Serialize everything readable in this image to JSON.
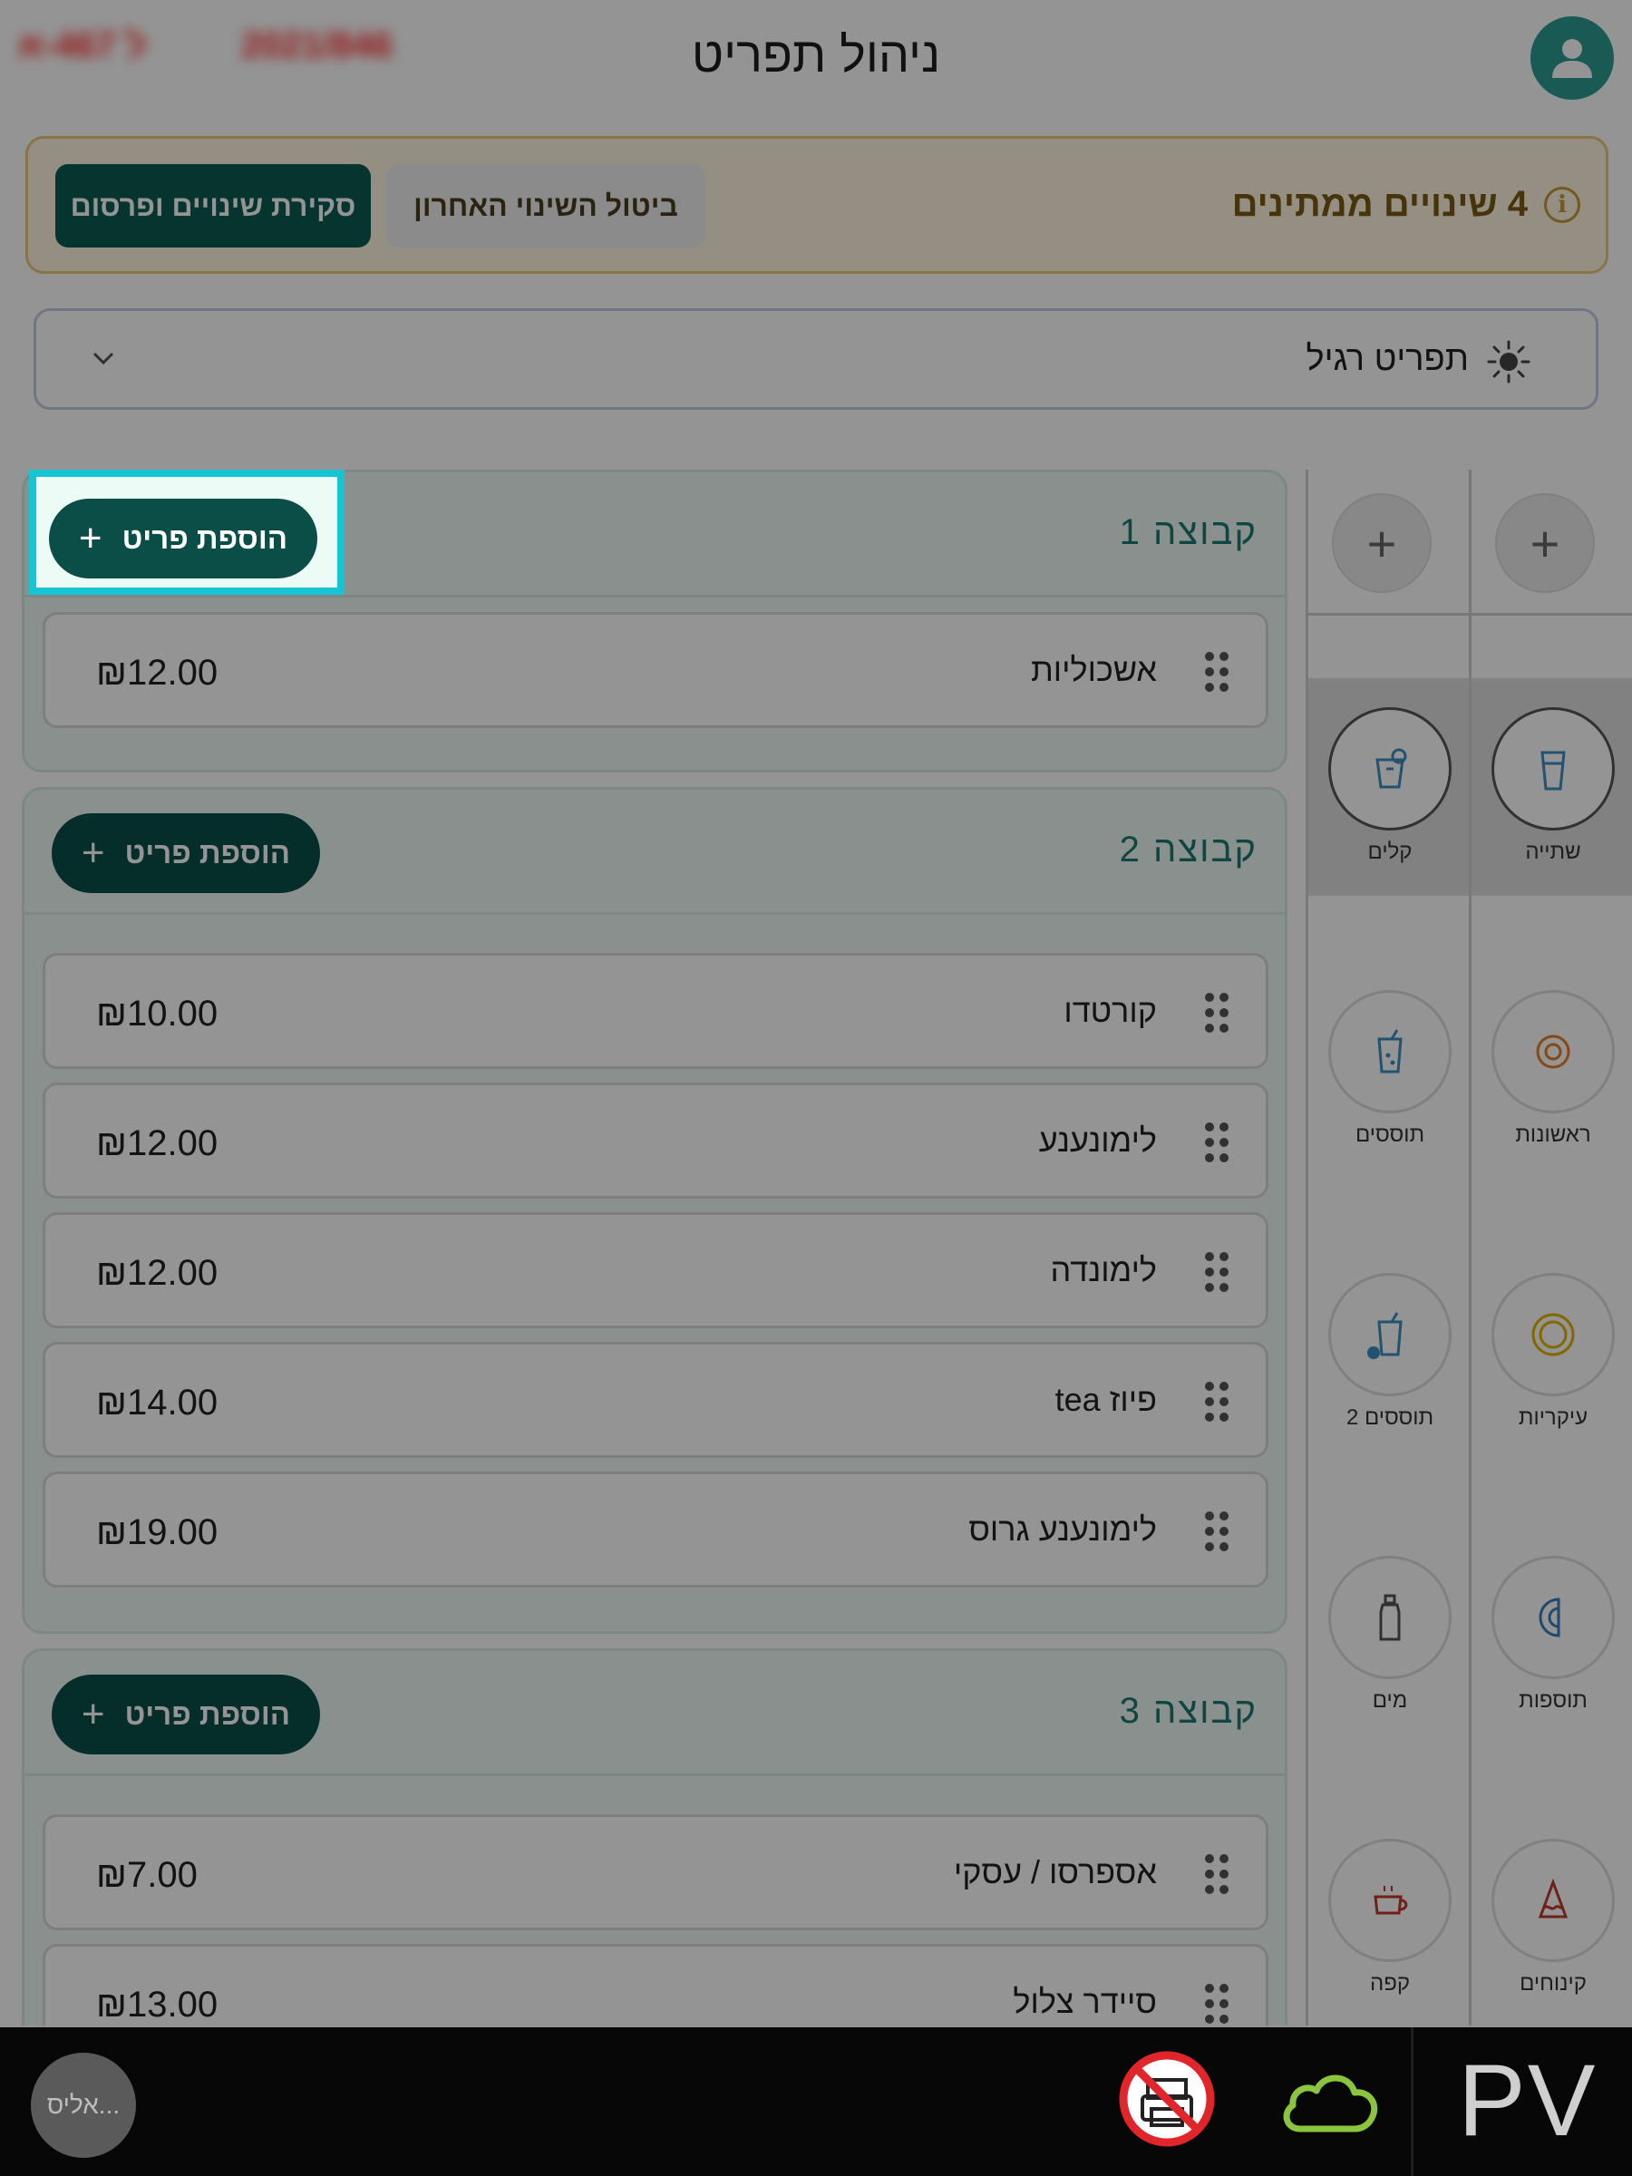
{
  "header": {
    "title": "ניהול תפריט",
    "blurred_left": "ל 467-א",
    "blurred_right": "2021/846"
  },
  "banner": {
    "pending_text": "4 שינויים ממתינים",
    "undo_label": "ביטול השינוי האחרון",
    "review_label": "סקירת שינויים ופרסום",
    "info_glyph": "i"
  },
  "menu_select": {
    "value": "תפריט רגיל"
  },
  "groups": [
    {
      "title": "קבוצה 1",
      "add_label": "הוספת פריט",
      "items": [
        {
          "name": "אשכוליות",
          "price": "₪12.00"
        }
      ]
    },
    {
      "title": "קבוצה 2",
      "add_label": "הוספת פריט",
      "items": [
        {
          "name": "קורטדו",
          "price": "₪10.00"
        },
        {
          "name": "לימונענע",
          "price": "₪12.00"
        },
        {
          "name": "לימונדה",
          "price": "₪12.00"
        },
        {
          "name": "פיוז tea",
          "price": "₪14.00"
        },
        {
          "name": "לימונענע גרוס",
          "price": "₪19.00"
        }
      ]
    },
    {
      "title": "קבוצה 3",
      "add_label": "הוספת פריט",
      "items": [
        {
          "name": "אספרסו / עסקי",
          "price": "₪7.00"
        },
        {
          "name": "סיידר צלול",
          "price": "₪13.00"
        }
      ]
    }
  ],
  "add_glyph": "+",
  "categories": {
    "right_column": [
      {
        "label": "שתייה",
        "icon": "glass-icon",
        "selected": true
      },
      {
        "label": "ראשונות",
        "icon": "small-plate-icon"
      },
      {
        "label": "עיקריות",
        "icon": "plate-icon"
      },
      {
        "label": "תוספות",
        "icon": "half-plate-icon"
      },
      {
        "label": "קינוחים",
        "icon": "cake-icon"
      }
    ],
    "left_column": [
      {
        "label": "קלים",
        "icon": "cold-drink-icon",
        "selected": true
      },
      {
        "label": "תוססים",
        "icon": "soda-icon"
      },
      {
        "label": "תוססים 2",
        "icon": "soda-icon"
      },
      {
        "label": "מים",
        "icon": "water-bottle-icon"
      },
      {
        "label": "קפה",
        "icon": "coffee-cup-icon"
      }
    ]
  },
  "bottom_bar": {
    "user_label": "אליס...",
    "logo": "PV"
  },
  "colors": {
    "primary": "#0a4e47",
    "accent_teal": "#2c9b92",
    "highlight": "#16c4d3",
    "banner_bg": "#fff6e0",
    "banner_border": "#ecc877"
  }
}
